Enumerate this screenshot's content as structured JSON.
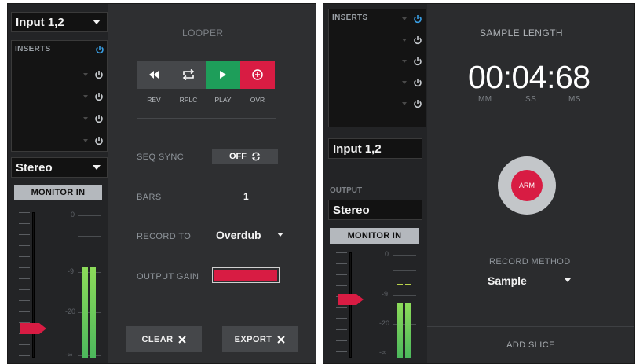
{
  "left_panel": {
    "input_select": {
      "value": "Input 1,2"
    },
    "inserts": {
      "label": "INSERTS",
      "slot_count": 4
    },
    "output_select": {
      "value": "Stereo"
    },
    "monitor_button": {
      "label": "MONITOR IN"
    },
    "meter_scale": [
      "0",
      "-9",
      "-20",
      "-∞"
    ],
    "meter_level_fraction": 0.64,
    "fader_level_fraction": 0.2,
    "looper": {
      "title": "LOOPER",
      "transport": [
        {
          "id": "rev",
          "label": "REV",
          "icon": "rewind-icon",
          "color": "#45474a"
        },
        {
          "id": "rplc",
          "label": "RPLC",
          "icon": "repeat-icon",
          "color": "#45474a"
        },
        {
          "id": "play",
          "label": "PLAY",
          "icon": "play-icon",
          "color": "#1e9e5a"
        },
        {
          "id": "ovr",
          "label": "OVR",
          "icon": "overdub-plus-icon",
          "color": "#d81c43"
        }
      ],
      "seq_sync": {
        "label": "SEQ SYNC",
        "value": "OFF"
      },
      "bars": {
        "label": "BARS",
        "value": "1"
      },
      "record_to": {
        "label": "RECORD TO",
        "value": "Overdub"
      },
      "output_gain": {
        "label": "OUTPUT GAIN",
        "level": 1.0
      },
      "clear_button": {
        "label": "CLEAR"
      },
      "export_button": {
        "label": "EXPORT"
      }
    }
  },
  "right_panel": {
    "inserts": {
      "label": "INSERTS",
      "slot_count": 5
    },
    "input_select": {
      "value": "Input 1,2"
    },
    "output_label": "OUTPUT",
    "output_select": {
      "value": "Stereo"
    },
    "monitor_button": {
      "label": "MONITOR IN"
    },
    "meter_scale": [
      "0",
      "-9",
      "-20",
      "-∞"
    ],
    "meter_level_fraction": 0.52,
    "fader_level_fraction": 0.55,
    "sample_length": {
      "title": "SAMPLE LENGTH",
      "time": "00:04:68",
      "units": [
        "MM",
        "SS",
        "MS"
      ]
    },
    "arm_button": {
      "label": "ARM"
    },
    "record_method": {
      "label": "RECORD METHOD",
      "value": "Sample"
    },
    "add_slice": {
      "label": "ADD SLICE"
    }
  },
  "colors": {
    "accent_red": "#d81c43",
    "accent_green": "#1e9e5a",
    "power_blue": "#3aa0e6",
    "meter_green": "#7ed957"
  }
}
